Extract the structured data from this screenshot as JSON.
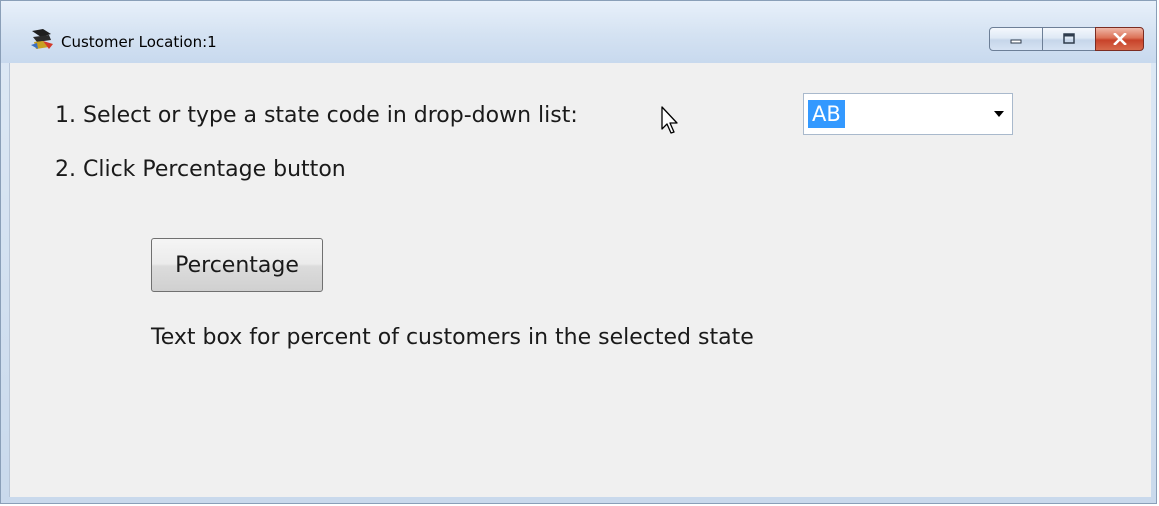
{
  "window": {
    "title": "Customer Location:1"
  },
  "titlebar": {
    "minimize_icon": "minimize-icon",
    "maximize_icon": "maximize-icon",
    "close_icon": "close-icon"
  },
  "instructions": {
    "step1": "1. Select or type a state code in drop-down list:",
    "step2": "2. Click Percentage button"
  },
  "state_dropdown": {
    "selected": "AB"
  },
  "buttons": {
    "percentage": "Percentage"
  },
  "result": {
    "text": "Text box for percent of customers in the selected state"
  },
  "colors": {
    "selection": "#3399ff",
    "client_background": "#f0f0f0",
    "close_button": "#c8432a"
  }
}
